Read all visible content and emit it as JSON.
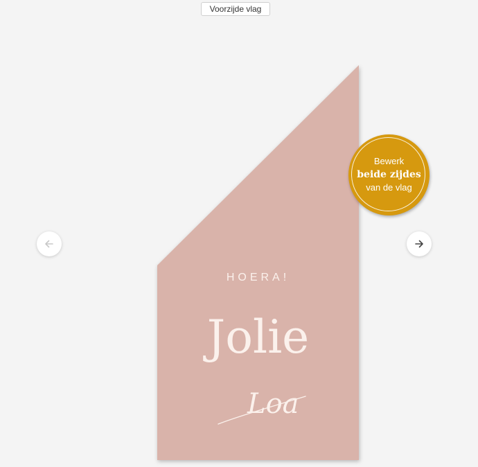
{
  "side_label": "Voorzijde vlag",
  "nav": {
    "prev_icon": "arrow-left-icon",
    "next_icon": "arrow-right-icon"
  },
  "flag": {
    "background_color": "#d9b3aa",
    "heading": "HOERA!",
    "name_main": "Jolie",
    "name_script": "Loa"
  },
  "badge": {
    "color": "#d6990f",
    "line1": "Bewerk",
    "line2": "beide zijdes",
    "line3": "van de vlag"
  }
}
